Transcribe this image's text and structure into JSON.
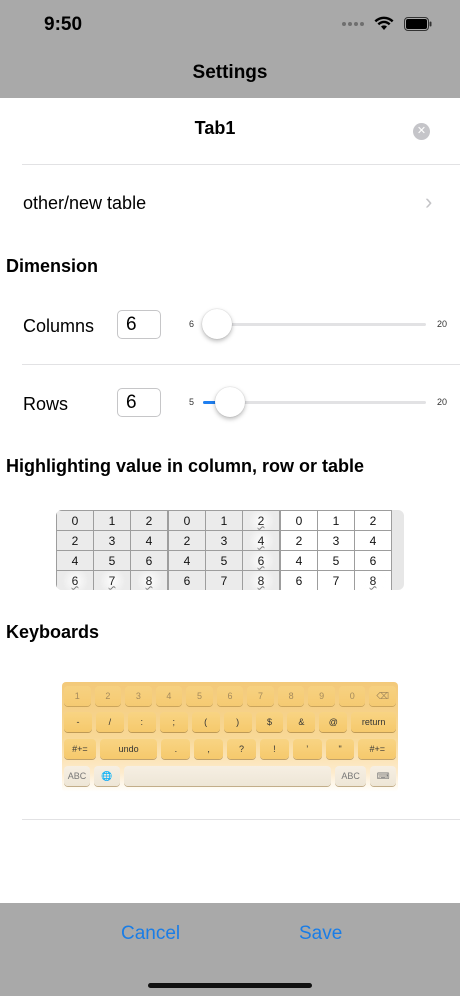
{
  "status": {
    "time": "9:50"
  },
  "nav": {
    "title": "Settings"
  },
  "table_name": {
    "value": "Tab1"
  },
  "other_row": {
    "label": "other/new table"
  },
  "dimension": {
    "title": "Dimension",
    "columns": {
      "label": "Columns",
      "value": "6",
      "min": "6",
      "max": "20",
      "fraction": 0.0
    },
    "rows": {
      "label": "Rows",
      "value": "6",
      "min": "5",
      "max": "20",
      "fraction": 0.067
    }
  },
  "highlighting": {
    "title": "Highlighting value in column, row or table",
    "tables": [
      {
        "rows": [
          [
            "0",
            "1",
            "2"
          ],
          [
            "2",
            "3",
            "4"
          ],
          [
            "4",
            "5",
            "6"
          ],
          [
            "6",
            "7",
            "8"
          ]
        ],
        "highlight": [
          [
            3,
            0
          ],
          [
            3,
            1
          ],
          [
            3,
            2
          ]
        ]
      },
      {
        "rows": [
          [
            "0",
            "1",
            "2"
          ],
          [
            "2",
            "3",
            "4"
          ],
          [
            "4",
            "5",
            "6"
          ],
          [
            "6",
            "7",
            "8"
          ]
        ],
        "highlight": [
          [
            0,
            2
          ],
          [
            1,
            2
          ],
          [
            2,
            2
          ],
          [
            3,
            2
          ]
        ]
      },
      {
        "rows": [
          [
            "0",
            "1",
            "2"
          ],
          [
            "2",
            "3",
            "4"
          ],
          [
            "4",
            "5",
            "6"
          ],
          [
            "6",
            "7",
            "8"
          ]
        ],
        "highlight": [
          [
            3,
            2
          ]
        ]
      }
    ]
  },
  "keyboards": {
    "title": "Keyboards",
    "row1": [
      "1",
      "2",
      "3",
      "4",
      "5",
      "6",
      "7",
      "8",
      "9",
      "0",
      "⌫"
    ],
    "row2": [
      "-",
      "/",
      ":",
      ";",
      "(",
      ")",
      "$",
      "&",
      "@",
      "return"
    ],
    "row3": [
      "#+=",
      "undo",
      ".",
      ",",
      "?",
      "!",
      "’",
      "\"",
      "#+="
    ],
    "row4": [
      "ABC",
      "🌐",
      "",
      "ABC",
      "⌨"
    ]
  },
  "footer": {
    "cancel": "Cancel",
    "save": "Save"
  },
  "colors": {
    "accent": "#1a7de6",
    "bar": "#a9a9a9",
    "keyboard": "#f6c96c"
  }
}
